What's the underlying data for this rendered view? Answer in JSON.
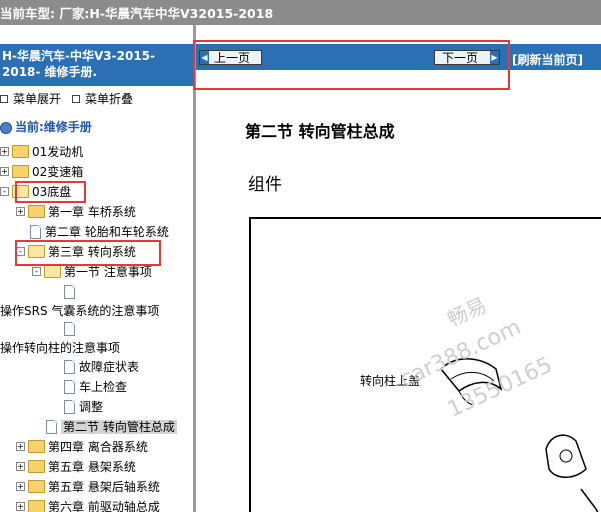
{
  "topbar": {
    "title": "当前车型:   厂家:H-华晨汽车中华V32015-2018"
  },
  "left_header": {
    "line1": "H-华晨汽车-中华V3-2015-",
    "line2": "2018- 维修手册."
  },
  "menu_controls": {
    "expand": "菜单展开",
    "collapse": "菜单折叠"
  },
  "tree": {
    "root": "当前:维修手册",
    "items": [
      {
        "label": "01发动机"
      },
      {
        "label": "02变速箱"
      },
      {
        "label": "03底盘"
      },
      {
        "label": "第一章 车桥系统"
      },
      {
        "label": "第二章 轮胎和车轮系统"
      },
      {
        "label": "第三章 转向系统"
      },
      {
        "label": "第一节 注意事项"
      },
      {
        "label": "操作SRS 气囊系统的注意事项"
      },
      {
        "label": "操作转向柱的注意事项"
      },
      {
        "label": "故障症状表"
      },
      {
        "label": "车上检查"
      },
      {
        "label": "调整"
      },
      {
        "label": "第二节 转向管柱总成"
      },
      {
        "label": "第四章 离合器系统"
      },
      {
        "label": "第五章 悬架系统"
      },
      {
        "label": "第五章 悬架后轴系统"
      },
      {
        "label": "第六章 前驱动轴总成"
      }
    ]
  },
  "nav": {
    "prev": "上一页",
    "next": "下一页",
    "refresh": "[刷新当前页]"
  },
  "content": {
    "title": "第二节 转向管柱总成",
    "subtitle": "组件",
    "figure_label": "转向柱上盖",
    "watermark": {
      "line1": "畅易",
      "line2": "car388.com",
      "line3": "13550165"
    }
  },
  "colors": {
    "header_blue": "#2b70b5",
    "topbar_gray": "#8c8c8c",
    "highlight_red": "#e53935"
  }
}
